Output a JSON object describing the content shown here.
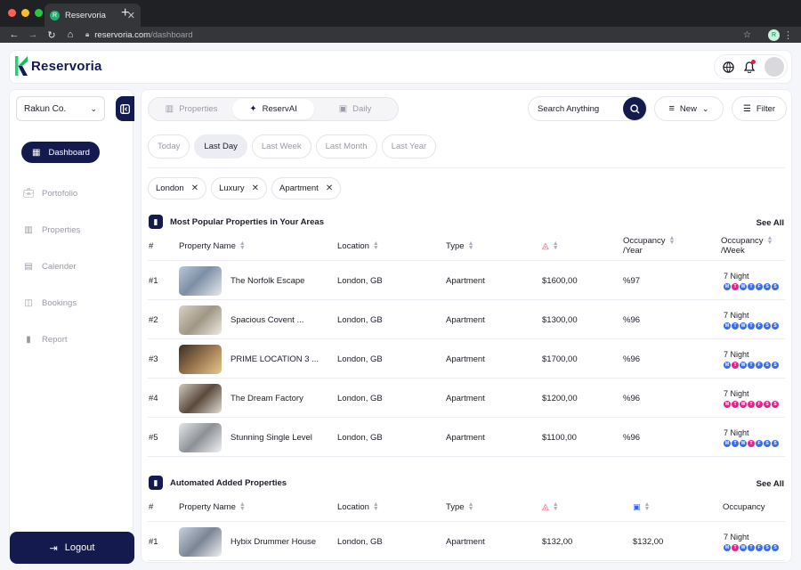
{
  "browser": {
    "tab_title": "Reservoria",
    "tab_close": "✕",
    "new_tab": "+",
    "url_host": "reservoria.com",
    "url_path": "/dashboard"
  },
  "brand": {
    "name": "Reservoria"
  },
  "sidebar": {
    "company": "Rakun Co.",
    "active_item": "Dashboard",
    "items": [
      {
        "label": "Portofolio",
        "icon": "briefcase-icon"
      },
      {
        "label": "Properties",
        "icon": "building-icon"
      },
      {
        "label": "Calender",
        "icon": "calendar-icon"
      },
      {
        "label": "Bookings",
        "icon": "bookings-icon"
      },
      {
        "label": "Report",
        "icon": "report-icon"
      }
    ],
    "logout": "Logout"
  },
  "toolbar": {
    "tabs": [
      {
        "label": "Properties",
        "active": false
      },
      {
        "label": "ReservAI",
        "active": true
      },
      {
        "label": "Daily",
        "active": false
      }
    ],
    "search_placeholder": "Search Anything",
    "new_label": "New",
    "filter_label": "Filter"
  },
  "ranges": [
    {
      "label": "Today",
      "active": false
    },
    {
      "label": "Last Day",
      "active": true
    },
    {
      "label": "Last Week",
      "active": false
    },
    {
      "label": "Last Month",
      "active": false
    },
    {
      "label": "Last Year",
      "active": false
    }
  ],
  "chips": [
    "London",
    "Luxury",
    "Apartment"
  ],
  "popular": {
    "title": "Most Popular Properties in Your Areas",
    "see_all": "See All",
    "headers": {
      "rank": "#",
      "name": "Property Name",
      "location": "Location",
      "type": "Type",
      "occ_year_1": "Occupancy",
      "occ_year_2": "/Year",
      "occ_week_1": "Occupancy",
      "occ_week_2": "/Week"
    },
    "rows": [
      {
        "rank": "#1",
        "name": "The Norfolk Escape",
        "location": "London, GB",
        "type": "Apartment",
        "price": "$1600,00",
        "occupancy": "%97",
        "nights": "7 Night",
        "days": [
          "M",
          "T",
          "W",
          "T",
          "F",
          "S",
          "S"
        ],
        "day_colors": [
          "#3a6ee8",
          "#e91e8c",
          "#3a6ee8",
          "#3a6ee8",
          "#3a6ee8",
          "#3a6ee8",
          "#3a6ee8"
        ]
      },
      {
        "rank": "#2",
        "name": "Spacious Covent ...",
        "location": "London, GB",
        "type": "Apartment",
        "price": "$1300,00",
        "occupancy": "%96",
        "nights": "7 Night",
        "days": [
          "M",
          "T",
          "W",
          "T",
          "F",
          "S",
          "S"
        ],
        "day_colors": [
          "#3a6ee8",
          "#3a6ee8",
          "#3a6ee8",
          "#3a6ee8",
          "#3a6ee8",
          "#3a6ee8",
          "#3a6ee8"
        ]
      },
      {
        "rank": "#3",
        "name": "PRIME LOCATION 3 ...",
        "location": "London, GB",
        "type": "Apartment",
        "price": "$1700,00",
        "occupancy": "%96",
        "nights": "7 Night",
        "days": [
          "M",
          "T",
          "W",
          "T",
          "F",
          "S",
          "S"
        ],
        "day_colors": [
          "#3a6ee8",
          "#e91e8c",
          "#3a6ee8",
          "#3a6ee8",
          "#3a6ee8",
          "#3a6ee8",
          "#3a6ee8"
        ]
      },
      {
        "rank": "#4",
        "name": "The Dream Factory",
        "location": "London, GB",
        "type": "Apartment",
        "price": "$1200,00",
        "occupancy": "%96",
        "nights": "7 Night",
        "days": [
          "M",
          "T",
          "W",
          "T",
          "F",
          "S",
          "S"
        ],
        "day_colors": [
          "#e91e8c",
          "#e91e8c",
          "#e91e8c",
          "#e91e8c",
          "#e91e8c",
          "#e91e8c",
          "#e91e8c"
        ]
      },
      {
        "rank": "#5",
        "name": "Stunning Single Level",
        "location": "London, GB",
        "type": "Apartment",
        "price": "$1100,00",
        "occupancy": "%96",
        "nights": "7 Night",
        "days": [
          "M",
          "T",
          "W",
          "T",
          "F",
          "S",
          "S"
        ],
        "day_colors": [
          "#3a6ee8",
          "#3a6ee8",
          "#3a6ee8",
          "#e91e8c",
          "#3a6ee8",
          "#3a6ee8",
          "#3a6ee8"
        ]
      }
    ]
  },
  "automated": {
    "title": "Automated Added Properties",
    "see_all": "See All",
    "headers": {
      "rank": "#",
      "name": "Property Name",
      "location": "Location",
      "type": "Type",
      "occupancy": "Occupancy"
    },
    "rows": [
      {
        "rank": "#1",
        "name": "Hybix Drummer House",
        "location": "London, GB",
        "type": "Apartment",
        "airbnb_price": "$132,00",
        "booking_price": "$132,00",
        "nights": "7 Night",
        "days": [
          "M",
          "T",
          "W",
          "T",
          "F",
          "S",
          "S"
        ],
        "day_colors": [
          "#3a6ee8",
          "#e91e8c",
          "#3a6ee8",
          "#3a6ee8",
          "#3a6ee8",
          "#3a6ee8",
          "#3a6ee8"
        ]
      }
    ]
  },
  "colors": {
    "navy": "#141a4e",
    "airbnb": "#ff385c",
    "booking": "#3467e8",
    "day_blue": "#3a6ee8",
    "day_pink": "#e91e8c"
  }
}
